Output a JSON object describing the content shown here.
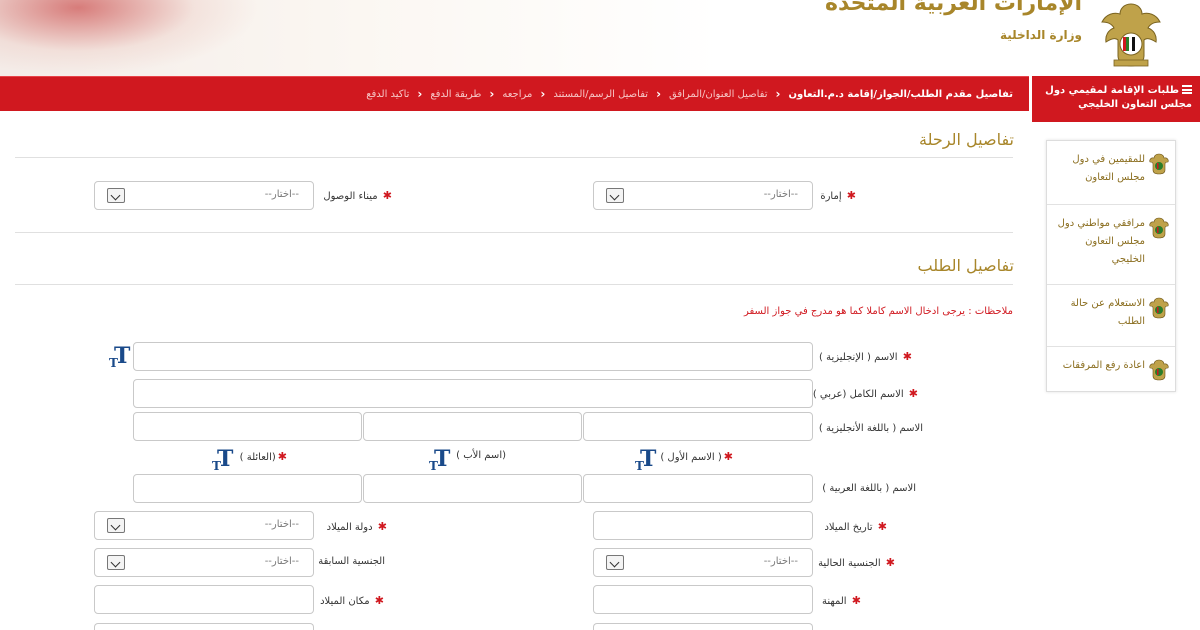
{
  "header": {
    "title": "الإمارات العربية المتحدة",
    "subtitle": "وزارة الداخلية",
    "emblem_icon": "uae-emblem-icon"
  },
  "navbar": {
    "steps": [
      "تفاصيل مقدم الطلب/الجواز/إقامة د.م.التعاون",
      "تفاصيل العنوان/المرافق",
      "تفاصيل الرسم/المستند",
      "مراجعه",
      "طريقة الدفع",
      "تاكيد الدفع"
    ],
    "active_index": 0
  },
  "sidebar": {
    "title": "طلبات الإقامة لمقيمي دول مجلس التعاون الخليجي",
    "items": [
      {
        "label": "للمقيمين في دول مجلس التعاون",
        "icon": "emblem-icon"
      },
      {
        "label": "مرافقي مواطني دول مجلس التعاون الخليجي",
        "icon": "emblem-icon"
      },
      {
        "label": "الاستعلام عن حالة الطلب",
        "icon": "emblem-icon"
      },
      {
        "label": "اعادة رفع المرفقات",
        "icon": "emblem-icon"
      }
    ]
  },
  "trip": {
    "title": "تفاصيل الرحلة",
    "emirate_label": "إمارة",
    "port_label": "ميناء الوصول",
    "select_placeholder": "--اختار--"
  },
  "request": {
    "title": "تفاصيل الطلب",
    "note": "ملاحظات : يرجى ادخال الاسم كاملا كما هو مدرج في جواز السفر",
    "name_en_label": "الاسم ( الإنجليزية )",
    "full_name_ar_label": "الاسم الكامل (عربي )",
    "name_in_en_label": "الاسم ( باللغة الأنجليزية )",
    "first_name_label": "( الاسم الأول )",
    "father_name_label": "(اسم الأب )",
    "family_name_label": "(العائلة )",
    "name_in_ar_label": "الاسم ( باللغة العربية )",
    "birth_date_label": "تاريخ الميلاد",
    "birth_country_label": "دولة الميلاد",
    "current_nationality_label": "الجنسية الحالية",
    "previous_nationality_label": "الجنسية السابقة",
    "profession_label": "المهنة",
    "birth_place_label": "مكان الميلاد",
    "select_placeholder": "--اختار--"
  },
  "colors": {
    "brand_red": "#d0181f",
    "gold": "#a8862a",
    "keyboard_icon_blue": "#1a4a8a"
  }
}
